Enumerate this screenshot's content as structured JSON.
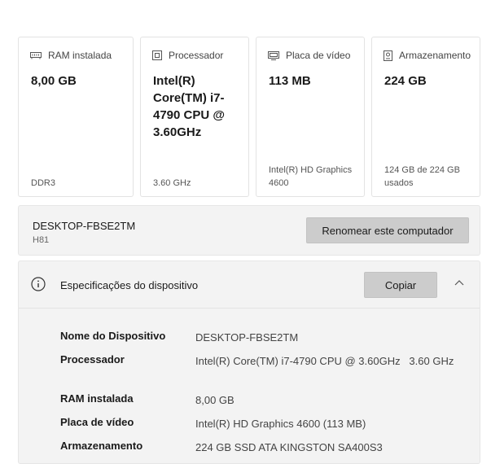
{
  "cards": [
    {
      "title": "RAM instalada",
      "value": "8,00 GB",
      "sub": "DDR3",
      "icon": "ram-icon"
    },
    {
      "title": "Processador",
      "value": "Intel(R) Core(TM) i7-4790 CPU @ 3.60GHz",
      "sub": "3.60 GHz",
      "icon": "processor-icon"
    },
    {
      "title": "Placa de vídeo",
      "value": "113 MB",
      "sub": "Intel(R) HD Graphics 4600",
      "icon": "display-icon"
    },
    {
      "title": "Armazenamento",
      "value": "224 GB",
      "sub": "124 GB de 224 GB usados",
      "icon": "storage-icon"
    }
  ],
  "device": {
    "name": "DESKTOP-FBSE2TM",
    "model": "H81",
    "rename_label": "Renomear este computador"
  },
  "specs": {
    "title": "Especificações do dispositivo",
    "copy_label": "Copiar",
    "icon": "info-icon",
    "rows": [
      {
        "label": "Nome do Dispositivo",
        "value": "DESKTOP-FBSE2TM"
      },
      {
        "label": "Processador",
        "value": "Intel(R) Core(TM) i7-4790 CPU @ 3.60GHz   3.60 GHz"
      },
      {
        "label": "RAM instalada",
        "value": "8,00 GB"
      },
      {
        "label": "Placa de vídeo",
        "value": "Intel(R) HD Graphics 4600 (113 MB)"
      },
      {
        "label": "Armazenamento",
        "value": "224 GB SSD ATA KINGSTON SA400S3"
      }
    ]
  }
}
